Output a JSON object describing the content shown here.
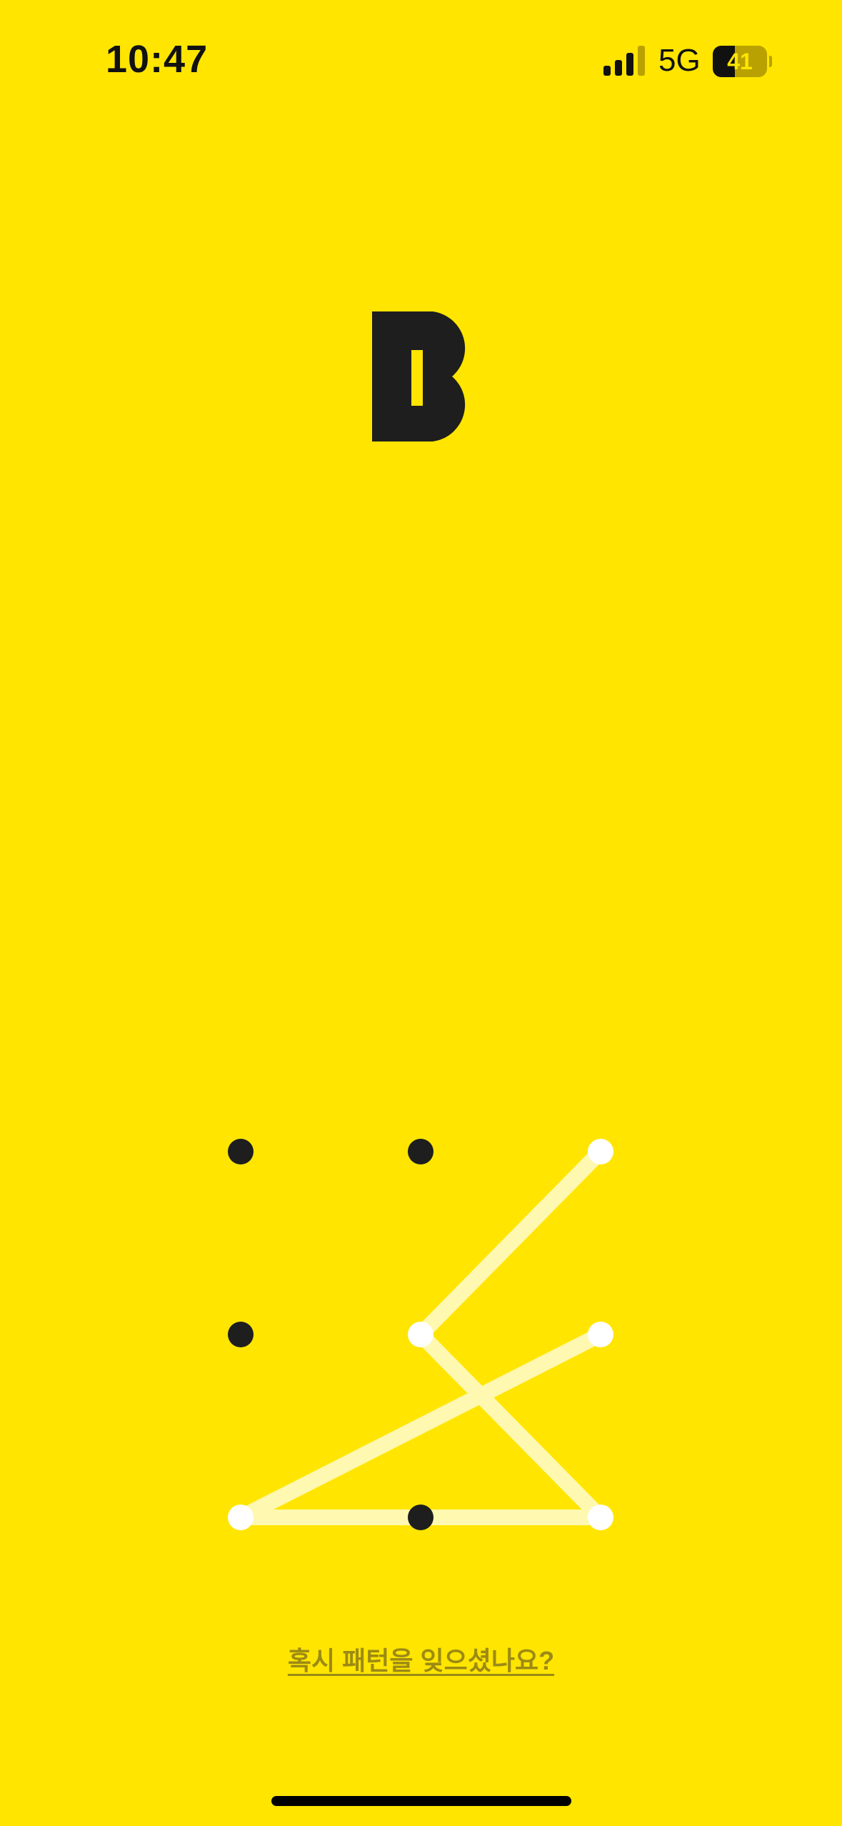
{
  "status_bar": {
    "time": "10:47",
    "network": "5G",
    "battery_percent": "41",
    "battery_level": 0.41,
    "signal_bars_active": 3,
    "signal_bars_total": 4
  },
  "logo": {
    "icon": "b-logo-icon",
    "color": "#1E1E1E"
  },
  "pattern": {
    "rows": 3,
    "columns": 3,
    "traced_sequence": [
      2,
      4,
      8,
      6,
      5
    ],
    "trace_color": "#FFFBD0",
    "dot_color": "#1E1E1E",
    "active_dot_color": "#FFFFFF"
  },
  "forgot_link": {
    "label": "혹시 패턴을 잊으셨나요?"
  },
  "colors": {
    "background": "#FFE500",
    "link": "#9C8A14"
  }
}
